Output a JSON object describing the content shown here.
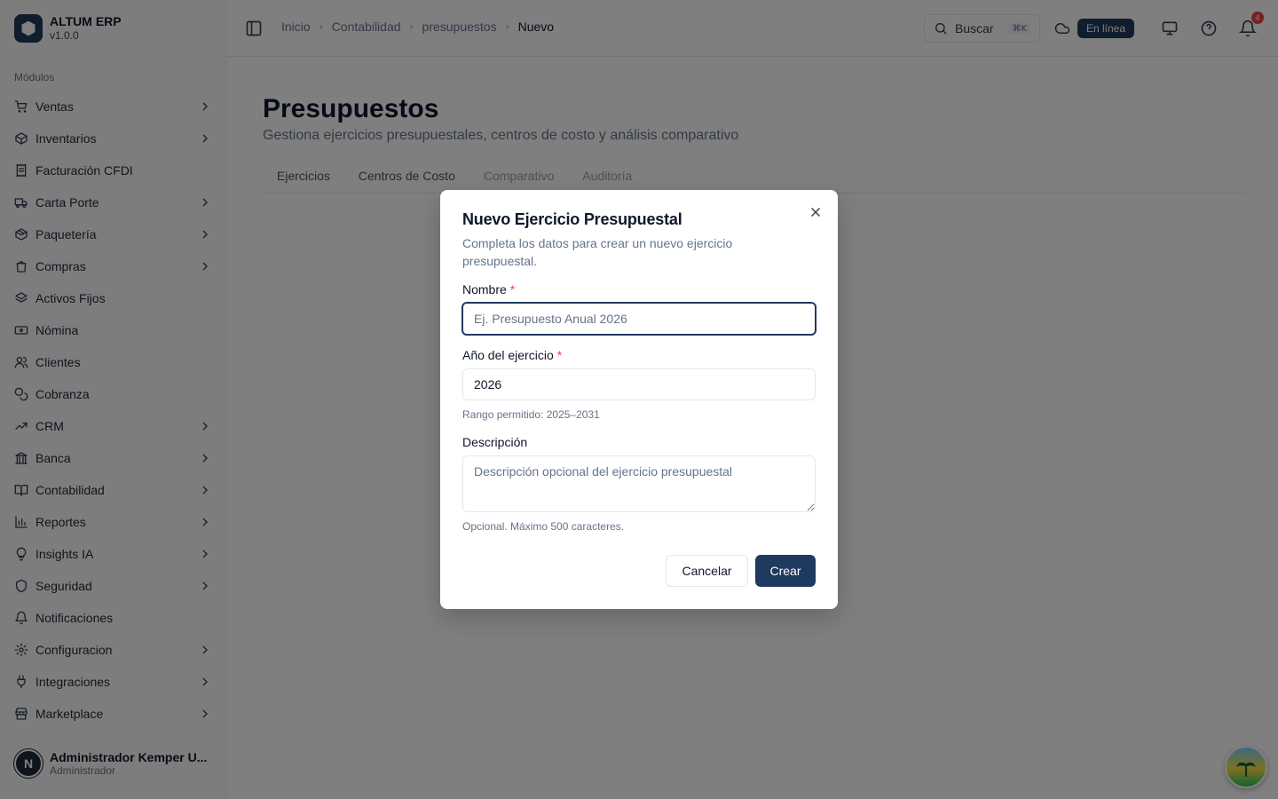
{
  "brand": {
    "name": "ALTUM ERP",
    "version": "v1.0.0"
  },
  "sidebar": {
    "section": "Módulos",
    "items": [
      {
        "label": "Ventas",
        "icon": "cart-icon",
        "chevron": true
      },
      {
        "label": "Inventarios",
        "icon": "box-icon",
        "chevron": true
      },
      {
        "label": "Facturación CFDI",
        "icon": "receipt-icon",
        "chevron": false
      },
      {
        "label": "Carta Porte",
        "icon": "truck-icon",
        "chevron": true
      },
      {
        "label": "Paquetería",
        "icon": "package-icon",
        "chevron": true
      },
      {
        "label": "Compras",
        "icon": "shopping-bag-icon",
        "chevron": true
      },
      {
        "label": "Activos Fijos",
        "icon": "layers-icon",
        "chevron": false
      },
      {
        "label": "Nómina",
        "icon": "banknote-icon",
        "chevron": false
      },
      {
        "label": "Clientes",
        "icon": "users-icon",
        "chevron": false
      },
      {
        "label": "Cobranza",
        "icon": "coins-icon",
        "chevron": false
      },
      {
        "label": "CRM",
        "icon": "trending-up-icon",
        "chevron": true
      },
      {
        "label": "Banca",
        "icon": "bank-icon",
        "chevron": true
      },
      {
        "label": "Contabilidad",
        "icon": "book-icon",
        "chevron": true
      },
      {
        "label": "Reportes",
        "icon": "bar-chart-icon",
        "chevron": true
      },
      {
        "label": "Insights IA",
        "icon": "lightbulb-icon",
        "chevron": true
      },
      {
        "label": "Seguridad",
        "icon": "shield-icon",
        "chevron": true
      },
      {
        "label": "Notificaciones",
        "icon": "bell-icon",
        "chevron": false
      },
      {
        "label": "Configuracion",
        "icon": "settings-icon",
        "chevron": true
      },
      {
        "label": "Integraciones",
        "icon": "plug-icon",
        "chevron": true
      },
      {
        "label": "Marketplace",
        "icon": "store-icon",
        "chevron": true
      }
    ]
  },
  "user": {
    "initial": "N",
    "name": "Administrador Kemper U...",
    "role": "Administrador"
  },
  "topbar": {
    "breadcrumbs": [
      "Inicio",
      "Contabilidad",
      "presupuestos",
      "Nuevo"
    ],
    "search_label": "Buscar",
    "search_shortcut": "⌘K",
    "status": "En línea",
    "notif_count": "4"
  },
  "page": {
    "title": "Presupuestos",
    "subtitle": "Gestiona ejercicios presupuestales, centros de costo y análisis comparativo",
    "tabs": [
      "Ejercicios",
      "Centros de Costo",
      "Comparativo",
      "Auditoría"
    ]
  },
  "dialog": {
    "title": "Nuevo Ejercicio Presupuestal",
    "description": "Completa los datos para crear un nuevo ejercicio presupuestal.",
    "name_label": "Nombre",
    "name_placeholder": "Ej. Presupuesto Anual 2026",
    "year_label": "Año del ejercicio",
    "year_value": "2026",
    "year_hint": "Rango permitido: 2025–2031",
    "desc_label": "Descripción",
    "desc_placeholder": "Descripción opcional del ejercicio presupuestal",
    "desc_hint": "Opcional. Máximo 500 caracteres.",
    "required_mark": "*",
    "cancel_label": "Cancelar",
    "create_label": "Crear"
  },
  "colors": {
    "primary": "#1f3a5f",
    "required": "#ef4444",
    "badge": "#ef4444"
  }
}
